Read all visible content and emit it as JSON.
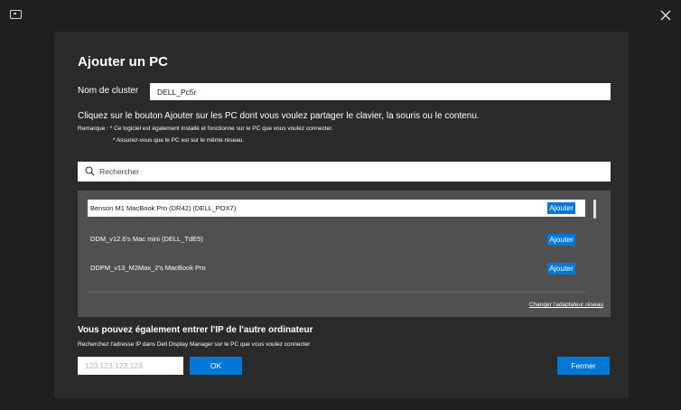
{
  "window": {
    "app_icon": "monitor-icon",
    "close_icon": "close-icon"
  },
  "dialog": {
    "title": "Ajouter un PC",
    "cluster_label": "Nom de cluster",
    "cluster_value": "DELL_Pc5r",
    "instructions": "Cliquez sur le bouton Ajouter sur les PC dont vous voulez partager le clavier, la souris ou le contenu.",
    "note_line1": "Remarque :  * Ce logiciel est également installé et fonctionne sur le PC que vous voulez connecter.",
    "note_line2": "* Assurez-vous que le PC est sur le même réseau.",
    "search_placeholder": "Rechercher",
    "pcs": [
      {
        "name": "Benson M1 MacBook Pro (DR42) (DELL_POX7)",
        "button": "Ajouter",
        "selected": true
      },
      {
        "name": "DDM_v12.6's Mac mini (DELL_TdE5)",
        "button": "Ajouter",
        "selected": false
      },
      {
        "name": "DDPM_v13_M2Max_2's MacBook Pro",
        "button": "Ajouter",
        "selected": false
      }
    ],
    "change_adapter_link": "Changer l'adaptateur réseau",
    "ip_title": "Vous pouvez également entrer l'IP de l'autre ordinateur",
    "ip_description": "Recherchez l'adresse IP dans Dell Display Manager sur le PC que vous voulez connecter",
    "ip_placeholder": "123.123.123.123",
    "ok_label": "OK",
    "close_label": "Fermer"
  },
  "colors": {
    "accent": "#0078d7",
    "background": "#1f1f1f",
    "panel": "#2a2a2a",
    "list": "#505050"
  }
}
